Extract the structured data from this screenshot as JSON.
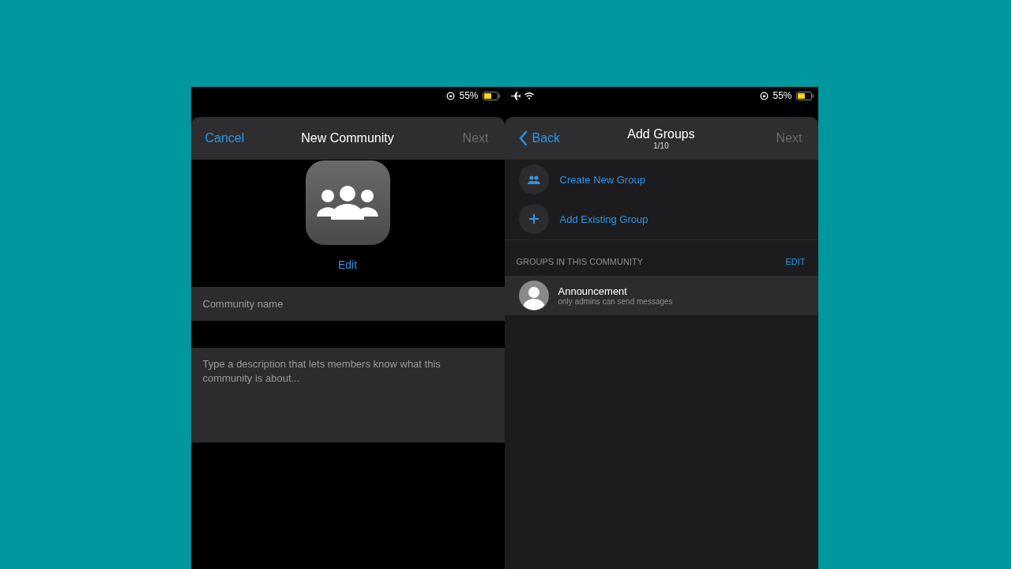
{
  "left_screen": {
    "status_bar": {
      "battery_text": "55%"
    },
    "header": {
      "cancel": "Cancel",
      "title": "New Community",
      "next": "Next"
    },
    "photo": {
      "edit": "Edit"
    },
    "name_field": {
      "placeholder": "Community name"
    },
    "description_field": {
      "placeholder": "Type a description that lets members know what this community is about..."
    }
  },
  "right_screen": {
    "status_bar": {
      "battery_text": "55%"
    },
    "header": {
      "back": "Back",
      "title": "Add Groups",
      "subtitle": "1/10",
      "next": "Next"
    },
    "actions": [
      {
        "kind": "create",
        "label": "Create New Group"
      },
      {
        "kind": "add",
        "label": "Add Existing Group"
      }
    ],
    "section": {
      "title": "GROUPS IN THIS COMMUNITY",
      "action": "EDIT"
    },
    "groups": [
      {
        "name": "Announcement",
        "subtitle": "only admins can send messages"
      }
    ]
  }
}
